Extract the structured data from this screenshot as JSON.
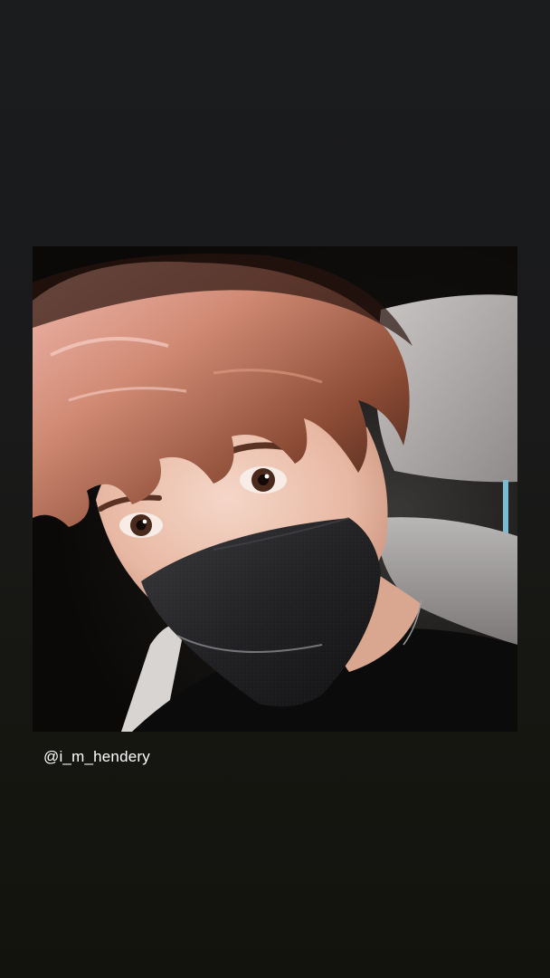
{
  "story": {
    "mention": "@i_m_hendery",
    "photo_subject": "masked-selfie"
  },
  "colors": {
    "background_top": "#1b1c1e",
    "background_bottom": "#13130e",
    "mention_text": "#ffffff"
  }
}
